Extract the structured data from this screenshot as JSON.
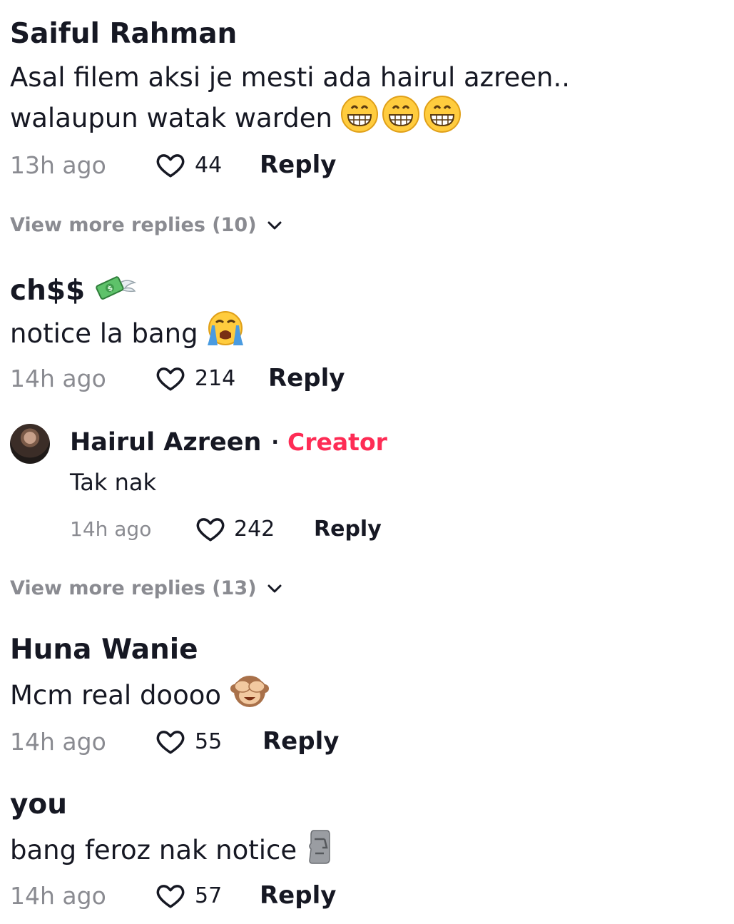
{
  "comments": [
    {
      "author": "Saiful Rahman",
      "text_line1": "Asal filem aksi je mesti ada hairul azreen..",
      "text_line2": "walaupun watak warden",
      "emoji": "grinning-face-icon",
      "time": "13h ago",
      "likes": "44",
      "reply_label": "Reply"
    },
    {
      "author": "ch$$",
      "author_emoji": "money-with-wings-icon",
      "text": "notice la bang",
      "emoji": "loudly-crying-face-icon",
      "time": "14h ago",
      "likes": "214",
      "reply_label": "Reply",
      "creator_reply": {
        "author": "Hairul Azreen",
        "separator": "·",
        "badge": "Creator",
        "text": "Tak nak",
        "time": "14h ago",
        "likes": "242",
        "reply_label": "Reply"
      }
    },
    {
      "author": "Huna Wanie",
      "text": "Mcm real doooo",
      "emoji": "see-no-evil-monkey-icon",
      "time": "14h ago",
      "likes": "55",
      "reply_label": "Reply"
    },
    {
      "author": "you",
      "text": "bang feroz nak notice",
      "emoji": "moai-icon",
      "time": "14h ago",
      "likes": "57",
      "reply_label": "Reply"
    }
  ],
  "view_more": [
    "View more replies (10)",
    "View more replies (13)"
  ],
  "colors": {
    "text_primary": "#161823",
    "text_secondary": "#8a8b91",
    "creator_accent": "#fe2c55"
  }
}
